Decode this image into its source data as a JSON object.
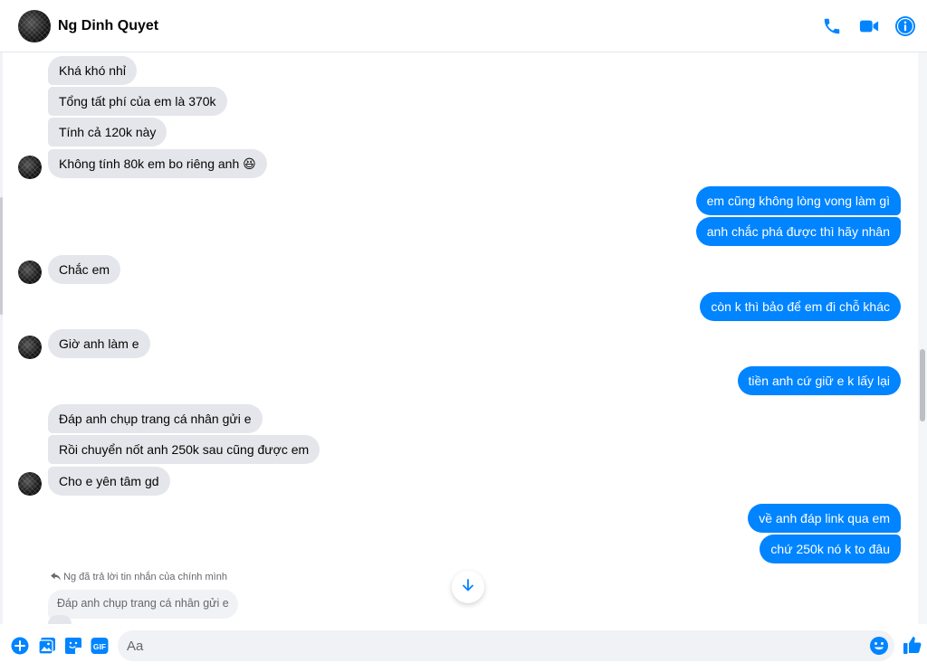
{
  "header": {
    "contact_name": "Ng Dinh Quyet",
    "icons": [
      "phone-icon",
      "video-camera-icon",
      "info-icon"
    ]
  },
  "colors": {
    "accent": "#0084ff",
    "incoming_bubble": "#e4e6eb",
    "outgoing_text": "#ffffff"
  },
  "messages": {
    "m1": "Khá khó nhỉ",
    "m2": "Tổng tất phí của em là 370k",
    "m3": "Tính cả 120k này",
    "m4": "Không tính 80k em bo riêng anh 😆",
    "m5": "em cũng không lòng vong làm gì",
    "m6": "anh chắc phá được thì hãy nhân",
    "m7": "Chắc em",
    "m8": "còn k thì bảo để em đi chỗ khác",
    "m9": "Giờ anh làm e",
    "m10": "tiền anh cứ giữ e k lấy lại",
    "m11": "Đáp anh chụp trang cá nhân gửi e",
    "m12": "Rồi chuyển nốt anh 250k sau cũng được em",
    "m13": "Cho e yên tâm gd",
    "m14": "về anh đáp link qua em",
    "m15": "chứ 250k nó k to đâu"
  },
  "reply": {
    "note": "Ng đã trả lời tin nhắn của chính mình",
    "quoted_text": "Đáp anh chụp trang cá nhân gửi e"
  },
  "composer": {
    "placeholder": "Aa",
    "icons": [
      "plus-icon",
      "image-icon",
      "sticker-icon",
      "gif-icon",
      "emoji-icon",
      "thumbs-up-icon"
    ],
    "gif_label": "GIF"
  }
}
